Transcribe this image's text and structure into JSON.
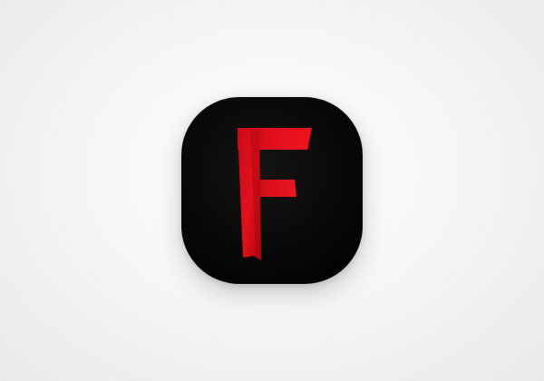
{
  "app_icon": {
    "glyph": "F",
    "icon": "letter-f-logo-icon",
    "colors": {
      "background": "#000000",
      "page_background": "#f2f2f2",
      "letter_bright": "#f0121d",
      "letter_dark": "#a80510",
      "letter_shadow": "#6e0009"
    }
  }
}
